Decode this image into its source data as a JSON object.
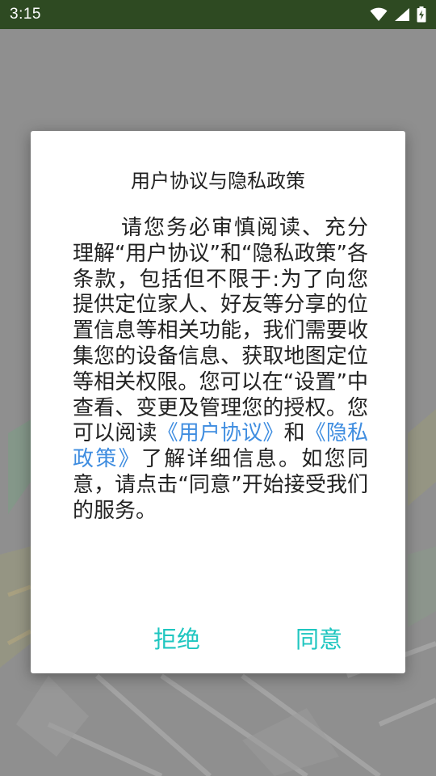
{
  "status_bar": {
    "time": "3:15",
    "icons": [
      "wifi-icon",
      "cellular-signal-icon",
      "battery-charging-icon"
    ],
    "background": "#2e4a22"
  },
  "dialog": {
    "title": "用户协议与隐私政策",
    "body_part1": "请您务必审慎阅读、充分理解“用户协议”和“隐私政策”各条款，包括但不限于:为了向您提供定位家人、好友等分享的位置信息等相关功能，我们需要收集您的设备信息、获取地图定位等相关权限。您可以在“设置”中查看、变更及管理您的授权。您可以阅读",
    "link_user_agreement": "《用户协议》",
    "connector": "和",
    "link_privacy_policy": "《隐私政策》",
    "body_part2": "了解详细信息。如您同意，请点击“同意”开始接受我们的服务。",
    "reject_label": "拒绝",
    "agree_label": "同意",
    "link_color": "#3f8de0",
    "button_color": "#1fc6c0"
  }
}
